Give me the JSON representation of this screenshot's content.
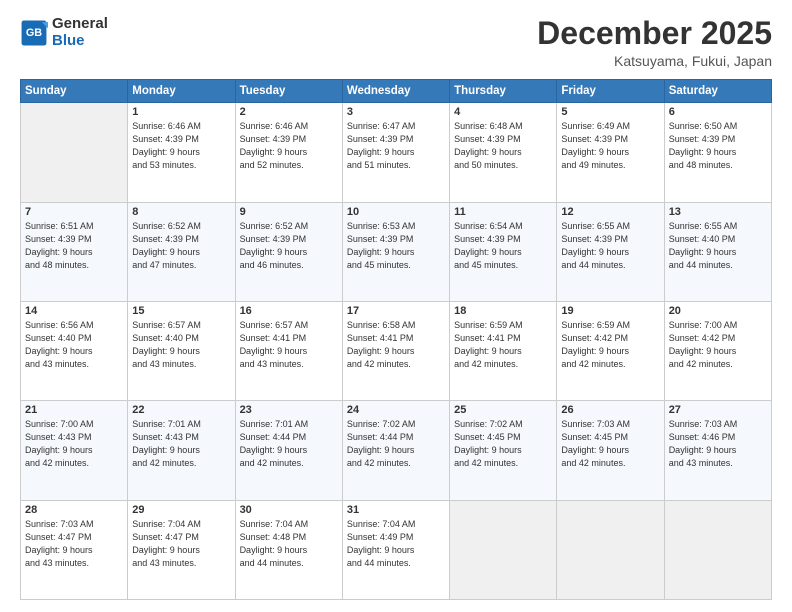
{
  "header": {
    "logo_general": "General",
    "logo_blue": "Blue",
    "month_title": "December 2025",
    "location": "Katsuyama, Fukui, Japan"
  },
  "days_of_week": [
    "Sunday",
    "Monday",
    "Tuesday",
    "Wednesday",
    "Thursday",
    "Friday",
    "Saturday"
  ],
  "weeks": [
    [
      {
        "day": "",
        "info": ""
      },
      {
        "day": "1",
        "info": "Sunrise: 6:46 AM\nSunset: 4:39 PM\nDaylight: 9 hours\nand 53 minutes."
      },
      {
        "day": "2",
        "info": "Sunrise: 6:46 AM\nSunset: 4:39 PM\nDaylight: 9 hours\nand 52 minutes."
      },
      {
        "day": "3",
        "info": "Sunrise: 6:47 AM\nSunset: 4:39 PM\nDaylight: 9 hours\nand 51 minutes."
      },
      {
        "day": "4",
        "info": "Sunrise: 6:48 AM\nSunset: 4:39 PM\nDaylight: 9 hours\nand 50 minutes."
      },
      {
        "day": "5",
        "info": "Sunrise: 6:49 AM\nSunset: 4:39 PM\nDaylight: 9 hours\nand 49 minutes."
      },
      {
        "day": "6",
        "info": "Sunrise: 6:50 AM\nSunset: 4:39 PM\nDaylight: 9 hours\nand 48 minutes."
      }
    ],
    [
      {
        "day": "7",
        "info": "Sunrise: 6:51 AM\nSunset: 4:39 PM\nDaylight: 9 hours\nand 48 minutes."
      },
      {
        "day": "8",
        "info": "Sunrise: 6:52 AM\nSunset: 4:39 PM\nDaylight: 9 hours\nand 47 minutes."
      },
      {
        "day": "9",
        "info": "Sunrise: 6:52 AM\nSunset: 4:39 PM\nDaylight: 9 hours\nand 46 minutes."
      },
      {
        "day": "10",
        "info": "Sunrise: 6:53 AM\nSunset: 4:39 PM\nDaylight: 9 hours\nand 45 minutes."
      },
      {
        "day": "11",
        "info": "Sunrise: 6:54 AM\nSunset: 4:39 PM\nDaylight: 9 hours\nand 45 minutes."
      },
      {
        "day": "12",
        "info": "Sunrise: 6:55 AM\nSunset: 4:39 PM\nDaylight: 9 hours\nand 44 minutes."
      },
      {
        "day": "13",
        "info": "Sunrise: 6:55 AM\nSunset: 4:40 PM\nDaylight: 9 hours\nand 44 minutes."
      }
    ],
    [
      {
        "day": "14",
        "info": "Sunrise: 6:56 AM\nSunset: 4:40 PM\nDaylight: 9 hours\nand 43 minutes."
      },
      {
        "day": "15",
        "info": "Sunrise: 6:57 AM\nSunset: 4:40 PM\nDaylight: 9 hours\nand 43 minutes."
      },
      {
        "day": "16",
        "info": "Sunrise: 6:57 AM\nSunset: 4:41 PM\nDaylight: 9 hours\nand 43 minutes."
      },
      {
        "day": "17",
        "info": "Sunrise: 6:58 AM\nSunset: 4:41 PM\nDaylight: 9 hours\nand 42 minutes."
      },
      {
        "day": "18",
        "info": "Sunrise: 6:59 AM\nSunset: 4:41 PM\nDaylight: 9 hours\nand 42 minutes."
      },
      {
        "day": "19",
        "info": "Sunrise: 6:59 AM\nSunset: 4:42 PM\nDaylight: 9 hours\nand 42 minutes."
      },
      {
        "day": "20",
        "info": "Sunrise: 7:00 AM\nSunset: 4:42 PM\nDaylight: 9 hours\nand 42 minutes."
      }
    ],
    [
      {
        "day": "21",
        "info": "Sunrise: 7:00 AM\nSunset: 4:43 PM\nDaylight: 9 hours\nand 42 minutes."
      },
      {
        "day": "22",
        "info": "Sunrise: 7:01 AM\nSunset: 4:43 PM\nDaylight: 9 hours\nand 42 minutes."
      },
      {
        "day": "23",
        "info": "Sunrise: 7:01 AM\nSunset: 4:44 PM\nDaylight: 9 hours\nand 42 minutes."
      },
      {
        "day": "24",
        "info": "Sunrise: 7:02 AM\nSunset: 4:44 PM\nDaylight: 9 hours\nand 42 minutes."
      },
      {
        "day": "25",
        "info": "Sunrise: 7:02 AM\nSunset: 4:45 PM\nDaylight: 9 hours\nand 42 minutes."
      },
      {
        "day": "26",
        "info": "Sunrise: 7:03 AM\nSunset: 4:45 PM\nDaylight: 9 hours\nand 42 minutes."
      },
      {
        "day": "27",
        "info": "Sunrise: 7:03 AM\nSunset: 4:46 PM\nDaylight: 9 hours\nand 43 minutes."
      }
    ],
    [
      {
        "day": "28",
        "info": "Sunrise: 7:03 AM\nSunset: 4:47 PM\nDaylight: 9 hours\nand 43 minutes."
      },
      {
        "day": "29",
        "info": "Sunrise: 7:04 AM\nSunset: 4:47 PM\nDaylight: 9 hours\nand 43 minutes."
      },
      {
        "day": "30",
        "info": "Sunrise: 7:04 AM\nSunset: 4:48 PM\nDaylight: 9 hours\nand 44 minutes."
      },
      {
        "day": "31",
        "info": "Sunrise: 7:04 AM\nSunset: 4:49 PM\nDaylight: 9 hours\nand 44 minutes."
      },
      {
        "day": "",
        "info": ""
      },
      {
        "day": "",
        "info": ""
      },
      {
        "day": "",
        "info": ""
      }
    ]
  ]
}
